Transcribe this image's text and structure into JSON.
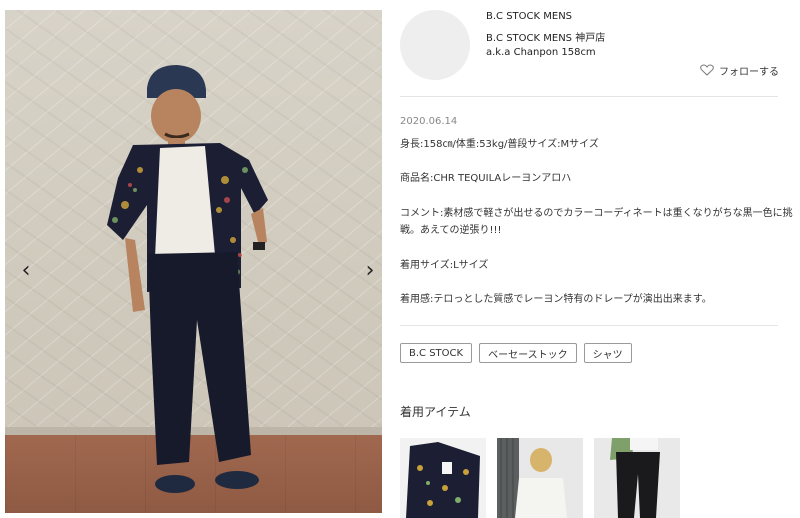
{
  "gallery": {
    "prev_arrow": "‹",
    "next_arrow": "›"
  },
  "profile": {
    "shop_name": "B.C STOCK MENS",
    "shop_branch": "B.C STOCK MENS 神戸店",
    "staff_name": "a.k.a Chanpon 158cm",
    "follow_label": "フォローする",
    "follow_icon": "heart-outline-icon"
  },
  "post": {
    "date": "2020.06.14",
    "body_info": "身長:158㎝/体重:53kg/普段サイズ:Mサイズ",
    "product": "商品名:CHR TEQUILAレーヨンアロハ",
    "comment_line1": "コメント:素材感で軽さが出せるのでカラーコーディネートは重くなりがちな黒一色に挑",
    "comment_line2": "戦。あえての逆張り!!!",
    "size_worn": "着用サイズ:Lサイズ",
    "fit_note": "着用感:テロっとした質感でレーヨン特有のドレープが演出出来ます。"
  },
  "tags": [
    "B.C STOCK",
    "ベーセーストック",
    "シャツ"
  ],
  "items": {
    "title": "着用アイテム"
  },
  "colors": {
    "wall": "#d3cdc1",
    "floor": "#955f47",
    "shirt": "#1c1f33",
    "pants": "#161a2b",
    "divider": "#e4e4e4",
    "avatar": "#eeeeee"
  }
}
